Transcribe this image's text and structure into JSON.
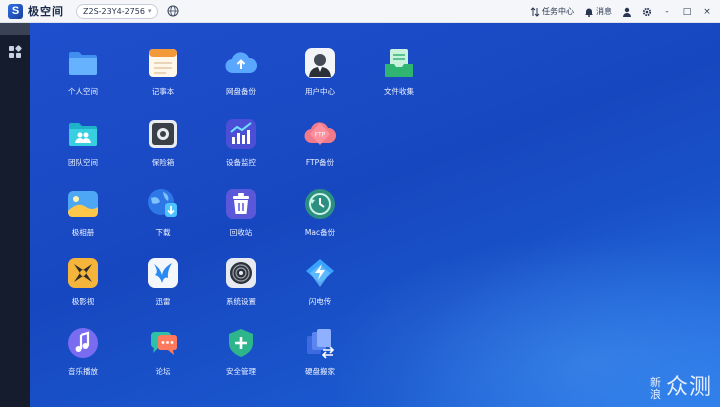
{
  "topbar": {
    "brand": "极空间",
    "device": "Z2S-23Y4-2756",
    "task_center": "任务中心",
    "messages": "消息",
    "window_controls": [
      "-",
      "□",
      "×"
    ]
  },
  "apps": [
    {
      "label": "个人空间",
      "icon": "folder-icon"
    },
    {
      "label": "记事本",
      "icon": "notepad-icon"
    },
    {
      "label": "网盘备份",
      "icon": "cloud-upload-icon"
    },
    {
      "label": "用户中心",
      "icon": "user-avatar-icon"
    },
    {
      "label": "文件收集",
      "icon": "file-collect-icon"
    },
    {
      "label": "团队空间",
      "icon": "team-folder-icon"
    },
    {
      "label": "保险箱",
      "icon": "safe-icon"
    },
    {
      "label": "设备监控",
      "icon": "monitor-chart-icon"
    },
    {
      "label": "FTP备份",
      "icon": "ftp-cloud-icon"
    },
    {
      "label": "极相册",
      "icon": "photo-icon"
    },
    {
      "label": "下载",
      "icon": "download-globe-icon"
    },
    {
      "label": "回收站",
      "icon": "trash-icon"
    },
    {
      "label": "Mac备份",
      "icon": "time-machine-icon"
    },
    {
      "label": "极影视",
      "icon": "video-icon"
    },
    {
      "label": "迅雷",
      "icon": "xunlei-icon"
    },
    {
      "label": "系统设置",
      "icon": "settings-dial-icon"
    },
    {
      "label": "闪电传",
      "icon": "lightning-transfer-icon"
    },
    {
      "label": "音乐播放",
      "icon": "music-icon"
    },
    {
      "label": "论坛",
      "icon": "forum-chat-icon"
    },
    {
      "label": "安全管理",
      "icon": "shield-plus-icon"
    },
    {
      "label": "硬盘搬家",
      "icon": "disk-move-icon"
    }
  ],
  "watermark": {
    "small": "新浪",
    "big": "众测"
  }
}
